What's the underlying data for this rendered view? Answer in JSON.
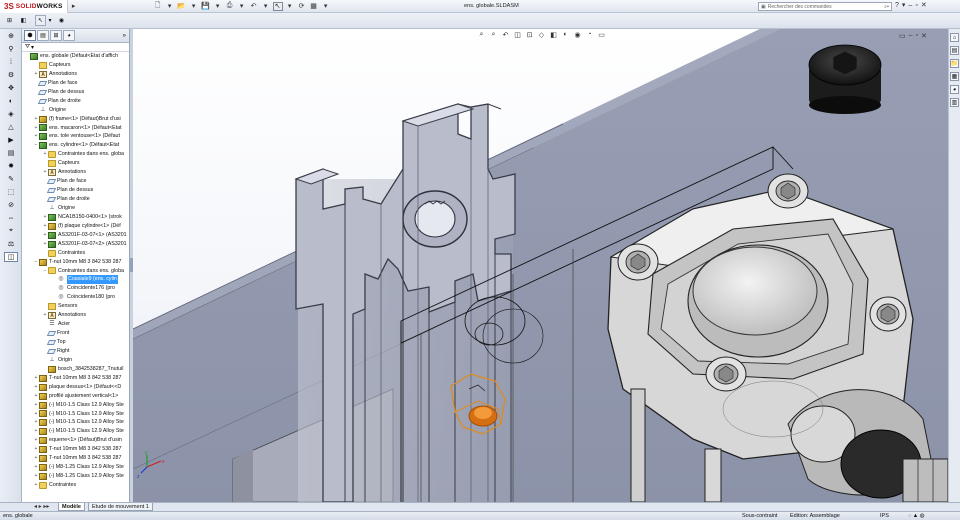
{
  "app": {
    "logo_mark": "3S",
    "logo_text_a": "SOLID",
    "logo_text_b": "WORKS",
    "window_title": "ens. globale.SLDASM"
  },
  "search": {
    "placeholder": "Rechercher des commandes"
  },
  "tree": {
    "filter_icon": "funnel-icon",
    "items": [
      {
        "indent": 0,
        "exp": "",
        "icon": "asm",
        "label": "ens. globale  (Défaut<Etat d'affich"
      },
      {
        "indent": 1,
        "exp": "",
        "icon": "sensor",
        "label": "Capteurs"
      },
      {
        "indent": 1,
        "exp": "+",
        "icon": "ann",
        "label": "Annotations"
      },
      {
        "indent": 1,
        "exp": "",
        "icon": "plane",
        "label": "Plan de face"
      },
      {
        "indent": 1,
        "exp": "",
        "icon": "plane",
        "label": "Plan de dessus"
      },
      {
        "indent": 1,
        "exp": "",
        "icon": "plane",
        "label": "Plan de droite"
      },
      {
        "indent": 1,
        "exp": "",
        "icon": "origin",
        "label": "Origine"
      },
      {
        "indent": 1,
        "exp": "+",
        "icon": "part",
        "label": "(f) frame<1> (Défaut)Brut d'usi"
      },
      {
        "indent": 1,
        "exp": "+",
        "icon": "asm",
        "label": "ens. macaron<1> (Défaut<Etat"
      },
      {
        "indent": 1,
        "exp": "+",
        "icon": "asm",
        "label": "ens. tole ventouse<1> (Défaut"
      },
      {
        "indent": 1,
        "exp": "−",
        "icon": "asm",
        "label": "ens. cylindre<1> (Défaut<Etat"
      },
      {
        "indent": 2,
        "exp": "+",
        "icon": "folder",
        "label": "Contraintes dans ens. globa"
      },
      {
        "indent": 2,
        "exp": "",
        "icon": "sensor",
        "label": "Capteurs"
      },
      {
        "indent": 2,
        "exp": "+",
        "icon": "ann",
        "label": "Annotations"
      },
      {
        "indent": 2,
        "exp": "",
        "icon": "plane",
        "label": "Plan de face"
      },
      {
        "indent": 2,
        "exp": "",
        "icon": "plane",
        "label": "Plan de dessus"
      },
      {
        "indent": 2,
        "exp": "",
        "icon": "plane",
        "label": "Plan de droite"
      },
      {
        "indent": 2,
        "exp": "",
        "icon": "origin",
        "label": "Origine"
      },
      {
        "indent": 2,
        "exp": "+",
        "icon": "asm",
        "label": "NCA1B150-0400<1> (strok"
      },
      {
        "indent": 2,
        "exp": "+",
        "icon": "part",
        "label": "(f) plaque cylindre<1> (Déf"
      },
      {
        "indent": 2,
        "exp": "+",
        "icon": "asm",
        "label": "AS3201F-03-07<1> (AS3201"
      },
      {
        "indent": 2,
        "exp": "+",
        "icon": "asm",
        "label": "AS3201F-03-07<2> (AS3201"
      },
      {
        "indent": 2,
        "exp": "",
        "icon": "folder",
        "label": "Contraintes"
      },
      {
        "indent": 1,
        "exp": "−",
        "icon": "part",
        "label": "T-nut 10mm M8 3 842 538 287"
      },
      {
        "indent": 2,
        "exp": "−",
        "icon": "folder",
        "label": "Contraintes dans ens. globa"
      },
      {
        "indent": 3,
        "exp": "",
        "icon": "mate",
        "label": "Coaxiale9 (ens. cylin",
        "selected": true
      },
      {
        "indent": 3,
        "exp": "",
        "icon": "mate",
        "label": "Coïncidente176 (pro"
      },
      {
        "indent": 3,
        "exp": "",
        "icon": "mate",
        "label": "Coïncidente180 (pro"
      },
      {
        "indent": 2,
        "exp": "",
        "icon": "sensor",
        "label": "Sensors"
      },
      {
        "indent": 2,
        "exp": "+",
        "icon": "ann",
        "label": "Annotations"
      },
      {
        "indent": 2,
        "exp": "",
        "icon": "mat",
        "label": "Acier"
      },
      {
        "indent": 2,
        "exp": "",
        "icon": "plane",
        "label": "Front"
      },
      {
        "indent": 2,
        "exp": "",
        "icon": "plane",
        "label": "Top"
      },
      {
        "indent": 2,
        "exp": "",
        "icon": "plane",
        "label": "Right"
      },
      {
        "indent": 2,
        "exp": "",
        "icon": "origin",
        "label": "Origin"
      },
      {
        "indent": 2,
        "exp": "",
        "icon": "part",
        "label": "bosch_3842538287_Tnutuil"
      },
      {
        "indent": 1,
        "exp": "+",
        "icon": "part",
        "label": "T-nut 10mm M8 3 842 538 287"
      },
      {
        "indent": 1,
        "exp": "+",
        "icon": "part",
        "label": "plaque dessus<1> (Défaut<<D"
      },
      {
        "indent": 1,
        "exp": "+",
        "icon": "part",
        "label": "profilé ajustement vertical<1>"
      },
      {
        "indent": 1,
        "exp": "+",
        "icon": "part",
        "label": "(-) M10-1.5 Class 12.9 Alloy Ste"
      },
      {
        "indent": 1,
        "exp": "+",
        "icon": "part",
        "label": "(-) M10-1.5 Class 12.9 Alloy Ste"
      },
      {
        "indent": 1,
        "exp": "+",
        "icon": "part",
        "label": "(-) M10-1.5 Class 12.9 Alloy Ste"
      },
      {
        "indent": 1,
        "exp": "+",
        "icon": "part",
        "label": "(-) M10-1.5 Class 12.9 Alloy Ste"
      },
      {
        "indent": 1,
        "exp": "+",
        "icon": "part",
        "label": "equerre<1> (Défaut)Brut d'usin"
      },
      {
        "indent": 1,
        "exp": "+",
        "icon": "part",
        "label": "T-nut 10mm M8 3 842 538 287"
      },
      {
        "indent": 1,
        "exp": "+",
        "icon": "part",
        "label": "T-nut 10mm M8 3 842 538 287"
      },
      {
        "indent": 1,
        "exp": "+",
        "icon": "part",
        "label": "(-) M8-1.25 Class 12.9 Alloy Ste"
      },
      {
        "indent": 1,
        "exp": "+",
        "icon": "part",
        "label": "(-) M8-1.25 Class 12.9 Alloy Ste"
      },
      {
        "indent": 1,
        "exp": "+",
        "icon": "folder",
        "label": "Contraintes"
      }
    ]
  },
  "tabs": {
    "model": "Modèle",
    "motion": "Etude de mouvement 1"
  },
  "status": {
    "doc": "ens. globale",
    "state": "Sous-contraint",
    "mode": "Edition: Assemblage",
    "units": "IPS"
  }
}
